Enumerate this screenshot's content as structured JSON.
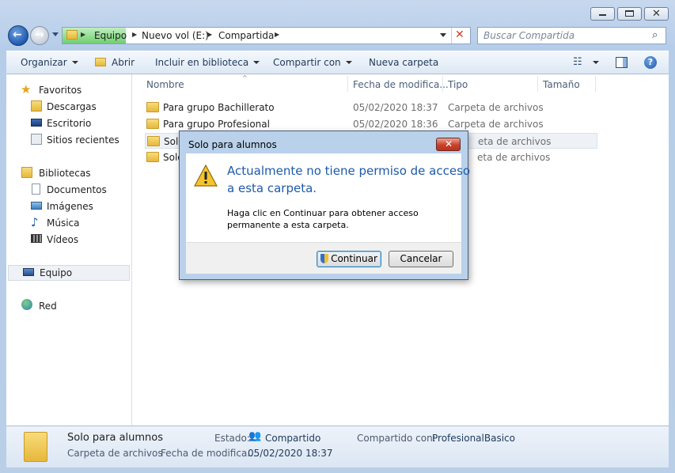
{
  "address": {
    "crumbs": [
      "Equipo",
      "Nuevo vol (E:)",
      "Compartida"
    ]
  },
  "search": {
    "placeholder": "Buscar Compartida"
  },
  "toolbar": {
    "organize": "Organizar",
    "open": "Abrir",
    "include": "Incluir en biblioteca",
    "share": "Compartir con",
    "new_folder": "Nueva carpeta"
  },
  "nav": {
    "favorites": "Favoritos",
    "downloads": "Descargas",
    "desktop": "Escritorio",
    "recent": "Sitios recientes",
    "libraries": "Bibliotecas",
    "documents": "Documentos",
    "images": "Imágenes",
    "music": "Música",
    "videos": "Vídeos",
    "computer": "Equipo",
    "network": "Red"
  },
  "columns": {
    "name": "Nombre",
    "date": "Fecha de modifica...",
    "type": "Tipo",
    "size": "Tamaño"
  },
  "files": [
    {
      "name": "Para grupo Bachillerato",
      "date": "05/02/2020 18:37",
      "type": "Carpeta de archivos"
    },
    {
      "name": "Para grupo Profesional",
      "date": "05/02/2020 18:36",
      "type": "Carpeta de archivos"
    },
    {
      "name": "Solo",
      "date": "",
      "type": "eta de archivos"
    },
    {
      "name": "Solo",
      "date": "",
      "type": "eta de archivos"
    }
  ],
  "details": {
    "name": "Solo para alumnos",
    "type": "Carpeta de archivos",
    "state_label": "Estado:",
    "state_value": "Compartido",
    "date_label": "Fecha de modifica...",
    "date_value": "05/02/2020 18:37",
    "shared_label": "Compartido con:",
    "shared_value": "ProfesionalBasico"
  },
  "dialog": {
    "title": "Solo para alumnos",
    "main_line1": "Actualmente no tiene permiso de acceso",
    "main_line2": "a esta carpeta.",
    "sub_line1": "Haga clic en Continuar para obtener acceso",
    "sub_line2": "permanente a esta carpeta.",
    "continue": "Continuar",
    "cancel": "Cancelar"
  },
  "colors": {
    "accent": "#1f5ab0",
    "dialog_heading": "#1e5aa8",
    "close_red": "#c8412d"
  }
}
